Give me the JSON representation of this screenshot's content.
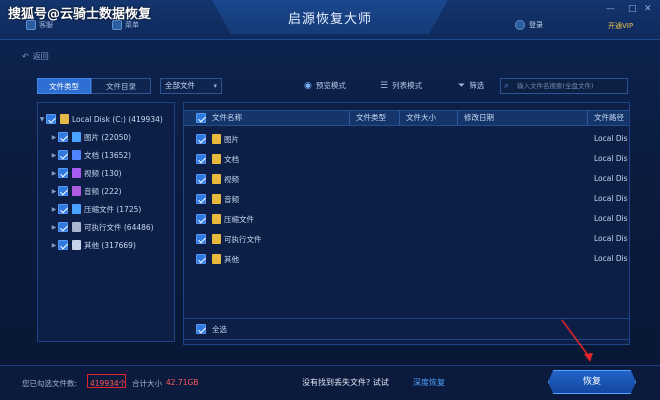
{
  "watermark": "搜狐号@云骑士数据恢复",
  "app": {
    "title": "启源恢复大师",
    "topbar": {
      "btn1": "客服",
      "btn2": "菜单",
      "login": "登录",
      "vip": "开通VIP"
    },
    "back": "返回"
  },
  "toolbar": {
    "tab_type": "文件类型",
    "tab_dir": "文件目录",
    "filter_value": "全部文件",
    "preview": "预览模式",
    "list": "列表模式",
    "filter": "筛选",
    "search_placeholder": "输入文件名搜索(全盘文件)"
  },
  "tree": {
    "root": "Local Disk (C:) (419934)",
    "items": [
      {
        "label": "图片 (22050)",
        "color": "#4aa3ff"
      },
      {
        "label": "文档 (13652)",
        "color": "#4f84ff"
      },
      {
        "label": "视频 (130)",
        "color": "#a85cf0"
      },
      {
        "label": "音频 (222)",
        "color": "#b05ce0"
      },
      {
        "label": "压缩文件 (1725)",
        "color": "#4aa3ff"
      },
      {
        "label": "可执行文件 (64486)",
        "color": "#a8b6d0"
      },
      {
        "label": "其他 (317669)",
        "color": "#c8d4e8"
      }
    ]
  },
  "table": {
    "headers": {
      "name": "文件名称",
      "type": "文件类型",
      "size": "文件大小",
      "date": "修改日期",
      "path": "文件路径"
    },
    "rows": [
      {
        "name": "图片",
        "path": "Local Dis"
      },
      {
        "name": "文档",
        "path": "Local Dis"
      },
      {
        "name": "视频",
        "path": "Local Dis"
      },
      {
        "name": "音频",
        "path": "Local Dis"
      },
      {
        "name": "压缩文件",
        "path": "Local Dis"
      },
      {
        "name": "可执行文件",
        "path": "Local Dis"
      },
      {
        "name": "其他",
        "path": "Local Dis"
      }
    ],
    "select_all": "全选"
  },
  "footer": {
    "selected_prefix": "您已勾选文件数:",
    "selected_count": "419934个",
    "total_label": "合计大小",
    "total_size": "42.71GB",
    "not_found": "没有找到丢失文件? 试试",
    "deep_link": "深度恢复",
    "recover": "恢复"
  },
  "colors": {
    "accent": "#2d6fd2",
    "danger": "#e0242a",
    "link": "#4da3ff",
    "folder": "#e8b83c"
  }
}
